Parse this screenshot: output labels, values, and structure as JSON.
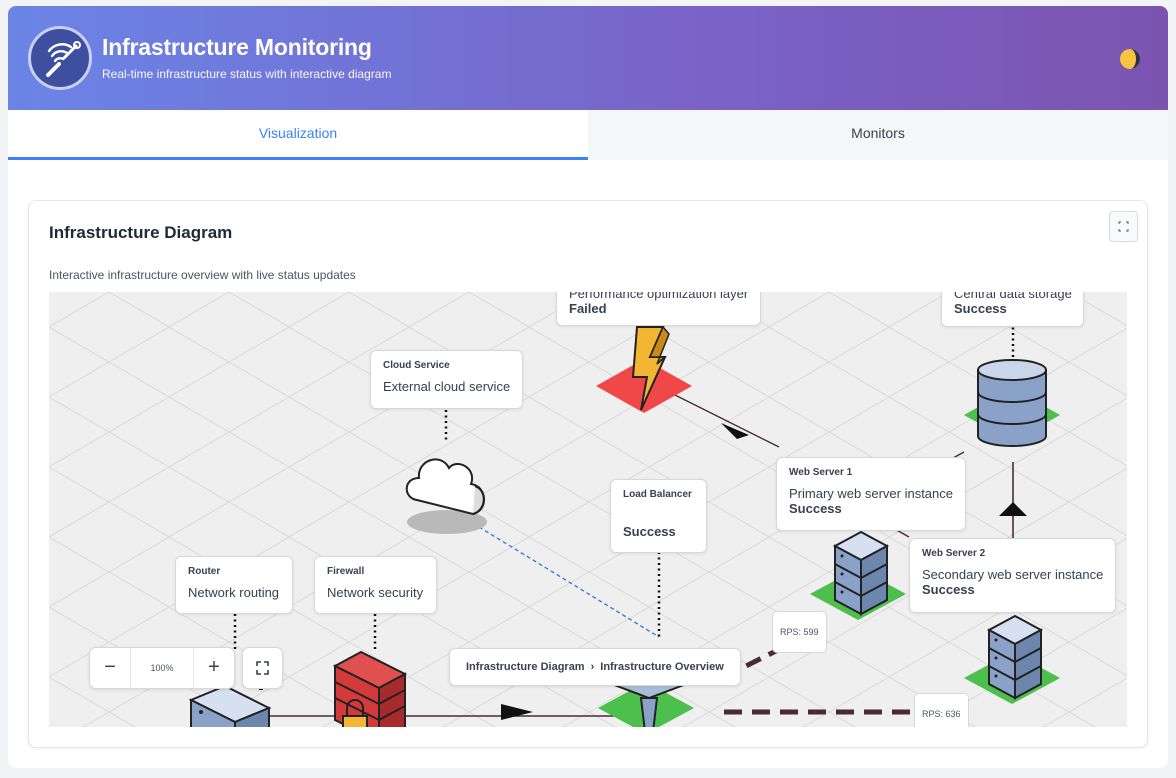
{
  "header": {
    "title": "Infrastructure Monitoring",
    "subtitle": "Real-time infrastructure status with interactive diagram",
    "logo_icon": "wifi-wrench-icon",
    "theme_icon": "half-moon-icon"
  },
  "tabs": [
    {
      "label": "Visualization",
      "active": true
    },
    {
      "label": "Monitors",
      "active": false
    }
  ],
  "card": {
    "title": "Infrastructure Diagram",
    "description": "Interactive infrastructure overview with live status updates",
    "expand_icon": "expand-icon"
  },
  "diagram": {
    "nodes": {
      "cache": {
        "title": "",
        "description": "Performance optimization layer",
        "status": "Failed",
        "icon": "lightning-icon"
      },
      "database": {
        "title": "",
        "description": "Central data storage",
        "status": "Success",
        "icon": "database-icon"
      },
      "cloud": {
        "title": "Cloud Service",
        "description": "External cloud service",
        "status": "",
        "icon": "cloud-icon"
      },
      "load_balancer": {
        "title": "Load Balancer",
        "description": "",
        "status": "Success",
        "icon": "load-balancer-icon"
      },
      "web1": {
        "title": "Web Server 1",
        "description": "Primary web server instance",
        "status": "Success",
        "icon": "server-icon"
      },
      "web2": {
        "title": "Web Server 2",
        "description": "Secondary web server instance",
        "status": "Success",
        "icon": "server-icon"
      },
      "router": {
        "title": "Router",
        "description": "Network routing",
        "status": "",
        "icon": "router-icon"
      },
      "firewall": {
        "title": "Firewall",
        "description": "Network security",
        "status": "",
        "icon": "firewall-icon"
      }
    },
    "edges": {
      "rps_web1": "RPS: 599",
      "rps_web2": "RPS: 636"
    },
    "status_colors": {
      "success": "#4cbf4c",
      "failed": "#f04848"
    },
    "zoom": {
      "level": "100%",
      "out_label": "−",
      "in_label": "+"
    },
    "breadcrumb": [
      "Infrastructure Diagram",
      "Infrastructure Overview"
    ]
  }
}
